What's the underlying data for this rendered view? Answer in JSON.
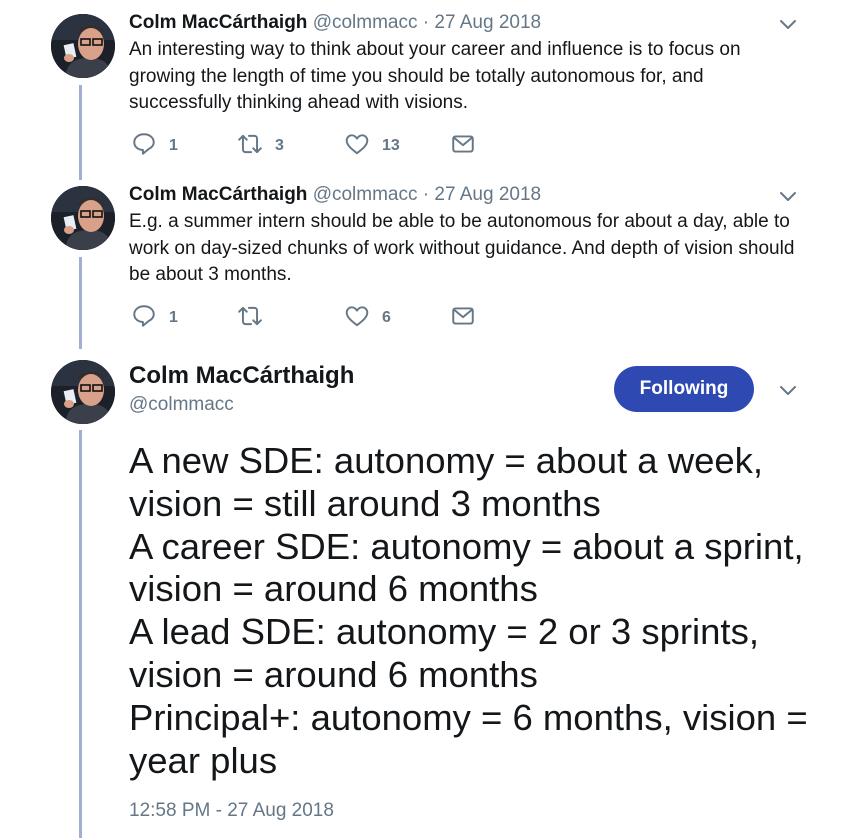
{
  "tweets": [
    {
      "author_name": "Colm MacCárthaigh",
      "author_handle": "@colmmacc",
      "separator": "·",
      "date": "27 Aug 2018",
      "text": "An interesting way to think about your career and influence is to focus on growing the length of time you should be totally autonomous for, and successfully thinking ahead with visions.",
      "replies": "1",
      "retweets": "3",
      "likes": "13"
    },
    {
      "author_name": "Colm MacCárthaigh",
      "author_handle": "@colmmacc",
      "separator": "·",
      "date": "27 Aug 2018",
      "text": "E.g. a summer intern should be able to be autonomous for about a day, able to work on day-sized chunks of work without guidance. And depth of vision should be about 3 months.",
      "replies": "1",
      "retweets": "",
      "likes": "6"
    }
  ],
  "main_tweet": {
    "author_name": "Colm MacCárthaigh",
    "author_handle": "@colmmacc",
    "follow_label": "Following",
    "text": "A new SDE:   autonomy = about a week, vision = still around 3 months\nA career SDE: autonomy = about a sprint, vision = around 6 months\nA lead SDE: autonomy = 2 or 3 sprints, vision = around 6 months\nPrincipal+: autonomy = 6 months, vision = year plus",
    "timestamp": "12:58 PM - 27 Aug 2018"
  },
  "colors": {
    "thread_line": "#a1aed6",
    "follow_button": "#2f49b3",
    "secondary_text": "#657786",
    "icon": "#657786"
  },
  "icons": [
    "reply-icon",
    "retweet-icon",
    "like-icon",
    "dm-icon",
    "chevron-down-icon"
  ]
}
